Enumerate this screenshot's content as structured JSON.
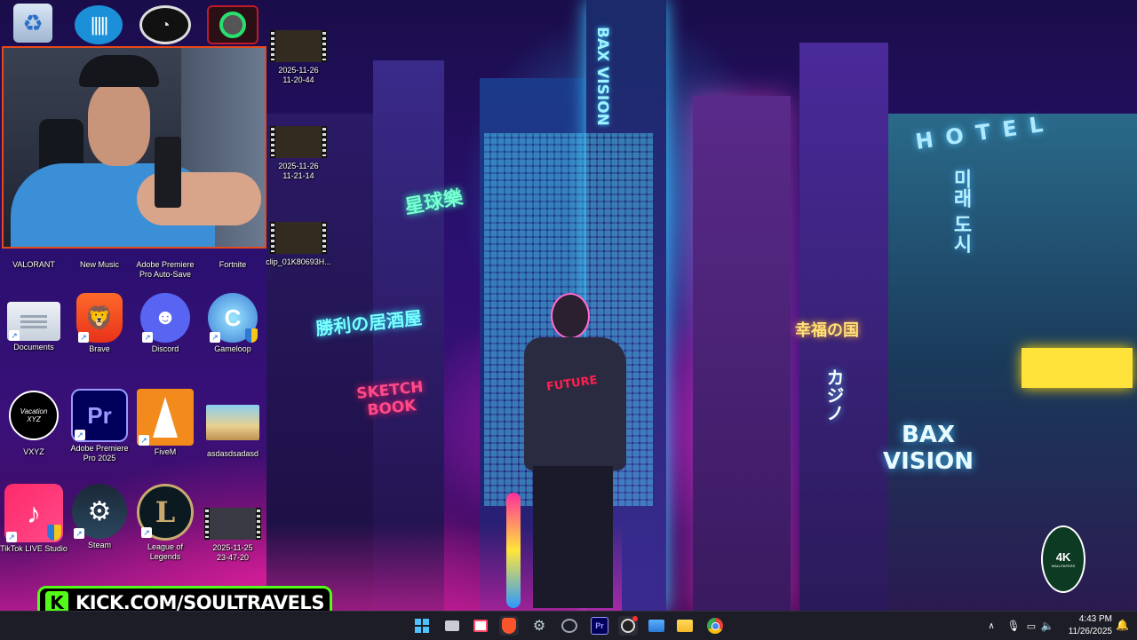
{
  "desktop": {
    "top_icons": [
      {
        "name": "recycle-bin-icon"
      },
      {
        "name": "app-waves-icon"
      },
      {
        "name": "obs-studio-icon"
      },
      {
        "name": "green-ring-app-icon"
      }
    ],
    "icons": [
      {
        "id": "valorant",
        "label": "VALORANT"
      },
      {
        "id": "new-music",
        "label": "New Music"
      },
      {
        "id": "premiere-autosave",
        "label": "Adobe Premiere Pro Auto-Save"
      },
      {
        "id": "fortnite",
        "label": "Fortnite"
      },
      {
        "id": "documents",
        "label": "Documents"
      },
      {
        "id": "brave",
        "label": "Brave"
      },
      {
        "id": "discord",
        "label": "Discord"
      },
      {
        "id": "gameloop",
        "label": "Gameloop"
      },
      {
        "id": "vxyz",
        "label": "VXYZ",
        "art_text": "Vacation XYZ"
      },
      {
        "id": "premiere-2025",
        "label": "Adobe Premiere Pro 2025",
        "art_text": "Pr"
      },
      {
        "id": "fivem",
        "label": "FiveM"
      },
      {
        "id": "asdasd",
        "label": "asdasdsadasd"
      },
      {
        "id": "tiktok-live",
        "label": "TikTok LIVE Studio"
      },
      {
        "id": "steam",
        "label": "Steam"
      },
      {
        "id": "lol",
        "label": "League of Legends"
      },
      {
        "id": "clip-1125",
        "label": "2025-11-25 23-47-20"
      }
    ],
    "video_files": [
      {
        "label": "2025-11-26 11-20-44"
      },
      {
        "label": "2025-11-26 11-21-14"
      },
      {
        "label": "clip_01K80693H..."
      }
    ]
  },
  "wallpaper": {
    "sign_top": "BAX VISION",
    "sign_big": "BAX VISION",
    "hotel": "HOTEL",
    "sketch": "SKETCH BOOK",
    "jp1": "勝利の居酒屋",
    "jp2": "星球樂",
    "jp3": "幸福の国",
    "kana": "カジノ",
    "shirt": "FUTURE",
    "korean": "미래 도시",
    "badge_line1": "4K",
    "badge_line2": "WALLPAPERS"
  },
  "overlay": {
    "kick_text": "KICK.COM/SOULTRAVELS",
    "kick_logo": "K"
  },
  "taskbar": {
    "apps": [
      "windows-start-icon",
      "file-folder-icon",
      "snipping-tool-icon",
      "brave-taskbar-icon",
      "steam-taskbar-icon",
      "keyboard-app-icon",
      "premiere-taskbar-icon",
      "obs-taskbar-icon",
      "photos-icon",
      "file-explorer-icon",
      "chrome-icon"
    ],
    "premiere_label": "Pr",
    "time": "4:43 PM",
    "date": "11/26/2025"
  },
  "colors": {
    "kick_green": "#53fc18",
    "webcam_border": "#e64a1a",
    "taskbar_bg": "#1c1d26"
  }
}
